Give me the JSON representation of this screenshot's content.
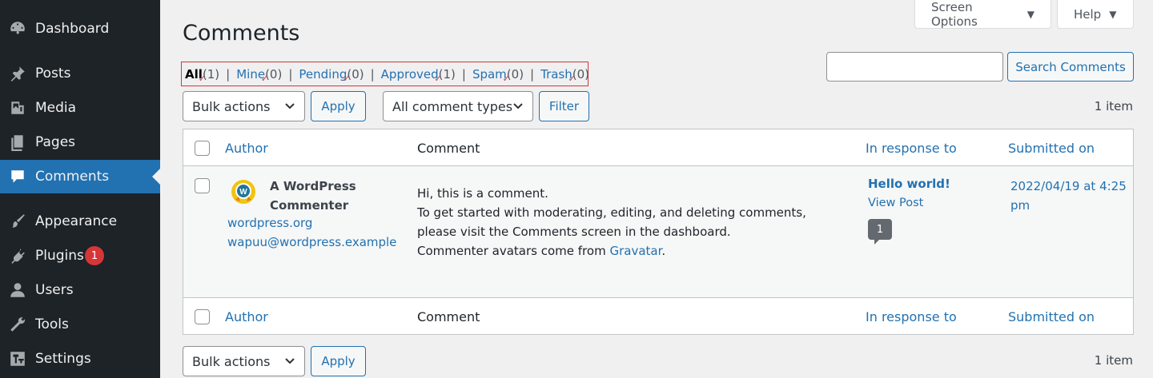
{
  "sidebar": {
    "items": [
      {
        "label": "Dashboard",
        "icon": "dashboard-icon"
      },
      {
        "label": "Posts",
        "icon": "pin-icon"
      },
      {
        "label": "Media",
        "icon": "media-icon"
      },
      {
        "label": "Pages",
        "icon": "pages-icon"
      },
      {
        "label": "Comments",
        "icon": "comment-icon",
        "active": true
      },
      {
        "label": "Appearance",
        "icon": "brush-icon"
      },
      {
        "label": "Plugins",
        "icon": "plugin-icon",
        "badge": "1"
      },
      {
        "label": "Users",
        "icon": "user-icon"
      },
      {
        "label": "Tools",
        "icon": "wrench-icon"
      },
      {
        "label": "Settings",
        "icon": "settings-icon"
      }
    ]
  },
  "header": {
    "screen_options": "Screen Options",
    "help": "Help",
    "title": "Comments"
  },
  "filters": [
    {
      "label": "All",
      "count": "(1)",
      "current": true
    },
    {
      "label": "Mine",
      "count": "(0)"
    },
    {
      "label": "Pending",
      "count": "(0)"
    },
    {
      "label": "Approved",
      "count": "(1)"
    },
    {
      "label": "Spam",
      "count": "(0)"
    },
    {
      "label": "Trash",
      "count": "(0)"
    }
  ],
  "search": {
    "placeholder": "",
    "button": "Search Comments"
  },
  "tablenav_top": {
    "bulk_actions": "Bulk actions",
    "apply": "Apply",
    "comment_types": "All comment types",
    "filter": "Filter",
    "items": "1 item"
  },
  "columns": {
    "author": "Author",
    "comment": "Comment",
    "in_response_to": "In response to",
    "submitted_on": "Submitted on"
  },
  "row": {
    "author_name": "A WordPress Commenter",
    "author_url": "wordpress.org",
    "author_email": "wapuu@wordpress.example",
    "comment_lines": [
      "Hi, this is a comment.",
      "To get started with moderating, editing, and deleting comments, please visit the Comments screen in the dashboard.",
      "Commenter avatars come from"
    ],
    "gravatar_link": "Gravatar",
    "period": ".",
    "response_title": "Hello world!",
    "view_post": "View Post",
    "comment_count": "1",
    "submitted": "2022/04/19 at 4:25 pm"
  },
  "tablenav_bottom": {
    "bulk_actions": "Bulk actions",
    "apply": "Apply",
    "items": "1 item"
  },
  "colors": {
    "sidebar_bg": "#1d2327",
    "accent": "#2271b1",
    "badge": "#d63638",
    "highlight_box": "#d63638"
  }
}
